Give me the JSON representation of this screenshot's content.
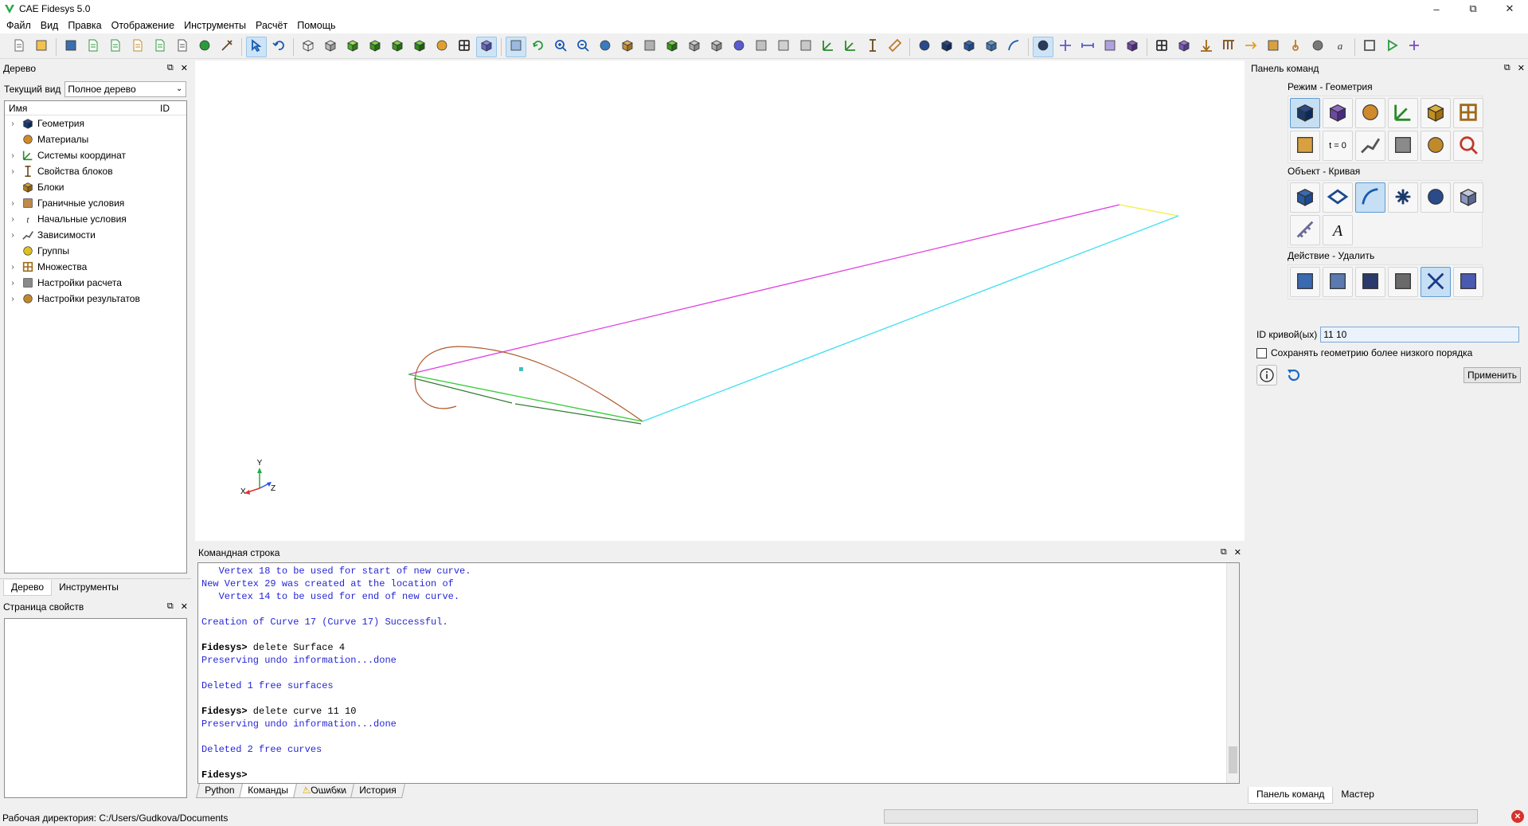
{
  "window": {
    "title": "CAE Fidesys 5.0"
  },
  "menu": [
    "Файл",
    "Вид",
    "Правка",
    "Отображение",
    "Инструменты",
    "Расчёт",
    "Помощь"
  ],
  "toolbar": {
    "icons": [
      "new-file",
      "open-folder",
      "save",
      "save-as",
      "export",
      "edit-script",
      "play-script",
      "journal",
      "stop-record",
      "tools",
      "select-mode",
      "undo",
      "wireframe-cube",
      "hidden-cube",
      "shaded-cube",
      "solid-cube",
      "assembly-cube",
      "mesh-cube",
      "probe",
      "grid-view",
      "box-select",
      "layers",
      "rotate",
      "zoom-in",
      "zoom-out",
      "zoom-fit",
      "perspective",
      "view-front",
      "view-back",
      "view-top",
      "view-iso",
      "view-fit",
      "view-left",
      "view-right",
      "view-bottom",
      "clip",
      "axis-triad",
      "dimension",
      "ruler",
      "volume-blocks",
      "volume",
      "surface",
      "surface-alt",
      "curve",
      "vertex",
      "plus",
      "minus",
      "square",
      "block",
      "mesh-grid",
      "cube-purple",
      "force",
      "load",
      "arrow-right",
      "beam",
      "thermometer",
      "gears",
      "letter-a",
      "frame",
      "run",
      "config"
    ],
    "active": [
      10,
      20,
      21,
      44
    ]
  },
  "left_dock": {
    "tree_title": "Дерево",
    "current_view_label": "Текущий вид",
    "current_view_value": "Полное дерево",
    "tree_header_name": "Имя",
    "tree_header_id": "ID",
    "tree_items": [
      {
        "label": "Геометрия",
        "icon": "geometry-icon",
        "expandable": true
      },
      {
        "label": "Материалы",
        "icon": "materials-icon",
        "expandable": false
      },
      {
        "label": "Системы координат",
        "icon": "coordinate-systems-icon",
        "expandable": true
      },
      {
        "label": "Свойства блоков",
        "icon": "block-properties-icon",
        "expandable": true
      },
      {
        "label": "Блоки",
        "icon": "blocks-icon",
        "expandable": false
      },
      {
        "label": "Граничные условия",
        "icon": "boundary-conditions-icon",
        "expandable": true
      },
      {
        "label": "Начальные условия",
        "icon": "initial-conditions-icon",
        "expandable": true
      },
      {
        "label": "Зависимости",
        "icon": "dependencies-icon",
        "expandable": true
      },
      {
        "label": "Группы",
        "icon": "groups-icon",
        "expandable": false
      },
      {
        "label": "Множества",
        "icon": "sets-icon",
        "expandable": true
      },
      {
        "label": "Настройки расчета",
        "icon": "calc-settings-icon",
        "expandable": true
      },
      {
        "label": "Настройки результатов",
        "icon": "results-settings-icon",
        "expandable": true
      }
    ],
    "tabs": [
      "Дерево",
      "Инструменты"
    ],
    "props_title": "Страница свойств"
  },
  "viewport": {
    "axes": {
      "x": "X",
      "y": "Y",
      "z": "Z"
    },
    "colors": {
      "top_edge": "#e040e0",
      "right_edge": "#40e0f0",
      "tip": "#f0f040",
      "airfoil": "#b05a2a",
      "lower_green": "#33cc33",
      "lower_dark": "#2e7a2e",
      "marker": "#40c0c0"
    }
  },
  "command": {
    "title": "Командная строка",
    "lines": [
      {
        "type": "out",
        "text": "   Vertex 18 to be used for start of new curve."
      },
      {
        "type": "out",
        "text": "New Vertex 29 was created at the location of"
      },
      {
        "type": "out",
        "text": "   Vertex 14 to be used for end of new curve."
      },
      {
        "type": "blank",
        "text": ""
      },
      {
        "type": "out",
        "text": "Creation of Curve 17 (Curve 17) Successful."
      },
      {
        "type": "blank",
        "text": ""
      },
      {
        "type": "prompt",
        "prompt": "Fidesys>",
        "text": " delete Surface 4"
      },
      {
        "type": "out",
        "text": "Preserving undo information...done"
      },
      {
        "type": "blank",
        "text": ""
      },
      {
        "type": "out",
        "text": "Deleted 1 free surfaces"
      },
      {
        "type": "blank",
        "text": ""
      },
      {
        "type": "prompt",
        "prompt": "Fidesys>",
        "text": " delete curve 11 10"
      },
      {
        "type": "out",
        "text": "Preserving undo information...done"
      },
      {
        "type": "blank",
        "text": ""
      },
      {
        "type": "out",
        "text": "Deleted 2 free curves"
      },
      {
        "type": "blank",
        "text": ""
      },
      {
        "type": "prompt",
        "prompt": "Fidesys>",
        "text": ""
      }
    ],
    "tabs": [
      "Python",
      "Команды",
      "Ошибки",
      "История"
    ],
    "active_tab": 1
  },
  "right_dock": {
    "title": "Панель команд",
    "mode_title": "Режим - Геометрия",
    "object_title": "Объект - Кривая",
    "action_title": "Действие - Удалить",
    "mode_icons": [
      "geometry-mode-icon",
      "mesh-mode-icon",
      "materials-mode-icon",
      "coordinate-mode-icon",
      "blocks-mode-icon",
      "sets-mode-icon",
      "loads-mode-icon",
      "initial-t0-icon",
      "plot-mode-icon",
      "calc-mode-icon",
      "results-mode-icon",
      "inspect-mode-icon"
    ],
    "object_icons": [
      "volume-object-icon",
      "surface-object-icon",
      "curve-object-icon",
      "vertex-object-icon",
      "group-object-icon",
      "body-object-icon",
      "measure-object-icon",
      "text-object-icon"
    ],
    "action_icons": [
      "create-action-icon",
      "modify-action-icon",
      "transform-action-icon",
      "settings-action-icon",
      "delete-action-icon",
      "copy-action-icon"
    ],
    "t0_label": "t = 0",
    "curve_id_label": "ID кривой(ых)",
    "curve_id_value": "11 10",
    "keep_lower_label": "Сохранять геометрию более низкого порядка",
    "apply_label": "Применить",
    "tabs": [
      "Панель команд",
      "Мастер"
    ]
  },
  "status": {
    "workdir": "Рабочая директория: C:/Users/Gudkova/Documents"
  }
}
